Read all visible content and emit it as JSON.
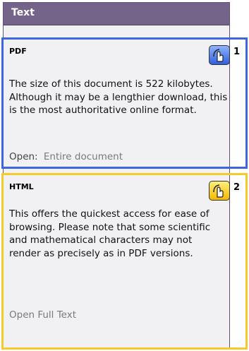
{
  "panel": {
    "title": "Text"
  },
  "pdf": {
    "label": "PDF",
    "description": "The size of this document is 522 kilobytes. Although it may be a lengthier download, this is the most authoritative online format.",
    "open_prefix": "Open:",
    "open_link": "Entire document",
    "badge_number": "1",
    "badge_icon": "hand-pointer-icon"
  },
  "html": {
    "label": "HTML",
    "description": "This offers the quickest access for ease of browsing. Please note that some scientific and mathematical characters may not render as precisely as in PDF versions.",
    "open_link": "Open Full Text",
    "badge_number": "2",
    "badge_icon": "hand-pointer-icon"
  },
  "colors": {
    "header": "#75648a",
    "pdf_highlight": "#3d66df",
    "html_highlight": "#f3cc2b"
  }
}
